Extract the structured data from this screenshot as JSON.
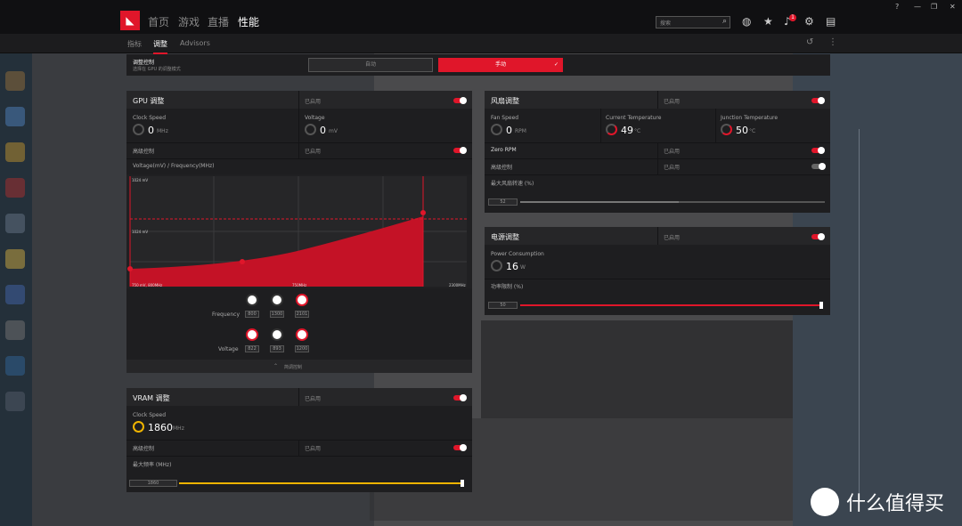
{
  "nav": {
    "items": [
      "首页",
      "游戏",
      "直播",
      "性能"
    ],
    "active": 3
  },
  "search": {
    "placeholder": "搜索"
  },
  "subnav": {
    "items": [
      "指标",
      "调整",
      "Advisors"
    ],
    "active": 1
  },
  "control": {
    "title": "调整控制",
    "subtitle": "选择在 GPU 的调整模式",
    "auto": "自动",
    "manual": "手动"
  },
  "gpu": {
    "title": "GPU 调整",
    "enabled": "已启用",
    "clock_label": "Clock Speed",
    "clock_value": "0",
    "clock_unit": "MHz",
    "volt_label": "Voltage",
    "volt_value": "0",
    "volt_unit": "mV",
    "adv": "高级控制",
    "adv_state": "已启用",
    "curve_title": "Voltage(mV) / Frequency(MHz)",
    "y_top": "1024 mV",
    "y_mid": "1024 mV",
    "x_left": "750 mV, 800MHz",
    "x_mid": "750MHz",
    "x_right": "2300MHz",
    "freq_label": "Frequency",
    "freq": [
      "800",
      "1300",
      "2101"
    ],
    "volt_lbl": "Voltage",
    "volt": [
      "822",
      "893",
      "1200"
    ],
    "collapse": "简调控制"
  },
  "vram": {
    "title": "VRAM 调整",
    "enabled": "已启用",
    "clock_label": "Clock Speed",
    "clock_value": "1860",
    "clock_unit": "MHz",
    "adv": "高级控制",
    "adv_state": "已启用",
    "max_label": "最大频率 (MHz)",
    "slider": "1860",
    "slider_fraction": 1.0
  },
  "fan": {
    "title": "风扇调整",
    "enabled": "已启用",
    "speed_label": "Fan Speed",
    "speed_value": "0",
    "speed_unit": "RPM",
    "temp_label": "Current Temperature",
    "temp_value": "49",
    "temp_unit": "°C",
    "jt_label": "Junction Temperature",
    "jt_value": "50",
    "jt_unit": "°C",
    "zero": "Zero RPM",
    "zero_state": "已启用",
    "adv": "高级控制",
    "adv_state": "已启用",
    "max_label": "最大风扇转速 (%)",
    "slider": "52",
    "slider_fraction": 0.52
  },
  "power": {
    "title": "电源调整",
    "enabled": "已启用",
    "cons_label": "Power Consumption",
    "cons_value": "16",
    "cons_unit": "W",
    "limit_label": "功率限制 (%)",
    "slider": "50",
    "slider_fraction": 1.0
  },
  "watermark": "什么值得买",
  "colors": {
    "accent": "#e0162a",
    "yellow": "#f0b400"
  }
}
